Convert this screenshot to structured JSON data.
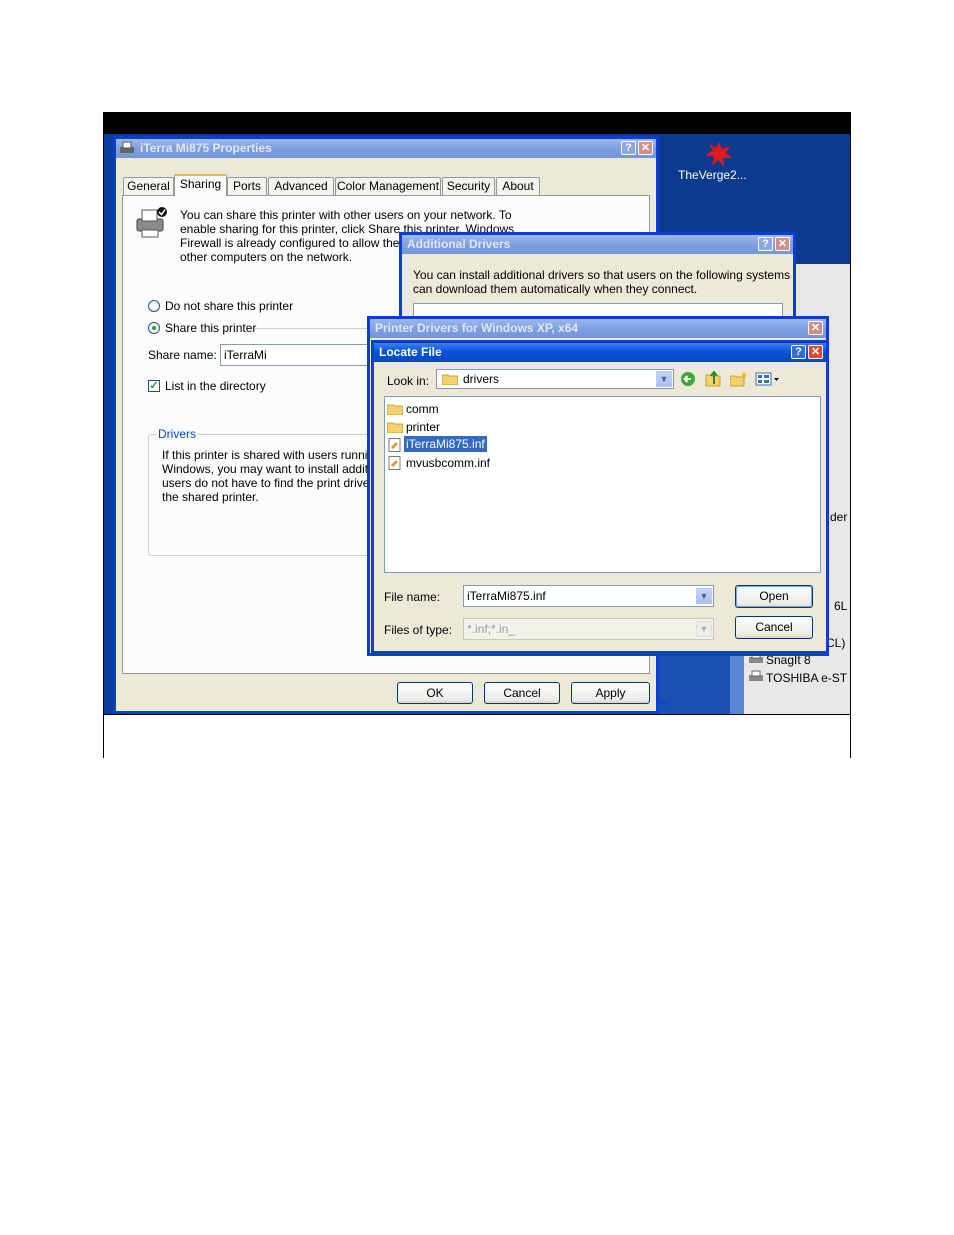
{
  "desktop": {
    "icon_label": "TheVerge2...",
    "strip_fragments": [
      "der",
      "6L",
      "CL)",
      "SnagIt 8",
      "TOSHIBA e-ST",
      "er"
    ]
  },
  "properties": {
    "title": "iTerra Mi875 Properties",
    "tabs": [
      "General",
      "Sharing",
      "Ports",
      "Advanced",
      "Color Management",
      "Security",
      "About"
    ],
    "active_tab": "Sharing",
    "intro_lines": [
      "You can share this printer with other users on your network.  To",
      "enable sharing for this printer, click Share this printer.  Windows",
      "Firewall is already configured to allow the",
      "other computers on the network."
    ],
    "radio_no_share": "Do not share this printer",
    "radio_share": "Share this printer",
    "share_name_label": "Share name:",
    "share_name_value": "iTerraMi",
    "list_in_directory": "List in the directory",
    "drivers_group": "Drivers",
    "drivers_lines": [
      "If this printer is shared with users runnin",
      "Windows, you may want to install additi",
      "users do not have to find the print drive",
      "the shared printer."
    ],
    "ok": "OK",
    "cancel": "Cancel",
    "apply": "Apply"
  },
  "additional_drivers": {
    "title": "Additional Drivers",
    "lines": [
      "You can install additional drivers so that users on the following systems",
      "can download them automatically when they connect."
    ]
  },
  "printer_drivers": {
    "title": "Printer Drivers for Windows XP, x64"
  },
  "locate_file": {
    "title": "Locate File",
    "look_in_label": "Look in:",
    "look_in_value": "drivers",
    "items": [
      {
        "name": "comm",
        "icon": "folder-icon"
      },
      {
        "name": "printer",
        "icon": "folder-icon"
      },
      {
        "name": "iTerraMi875.inf",
        "icon": "inf-file-icon",
        "selected": true
      },
      {
        "name": "mvusbcomm.inf",
        "icon": "inf-file-icon"
      }
    ],
    "file_name_label": "File name:",
    "file_name_value": "iTerraMi875.inf",
    "file_type_label": "Files of type:",
    "file_type_value": "*.inf;*.in_",
    "open": "Open",
    "cancel": "Cancel"
  }
}
